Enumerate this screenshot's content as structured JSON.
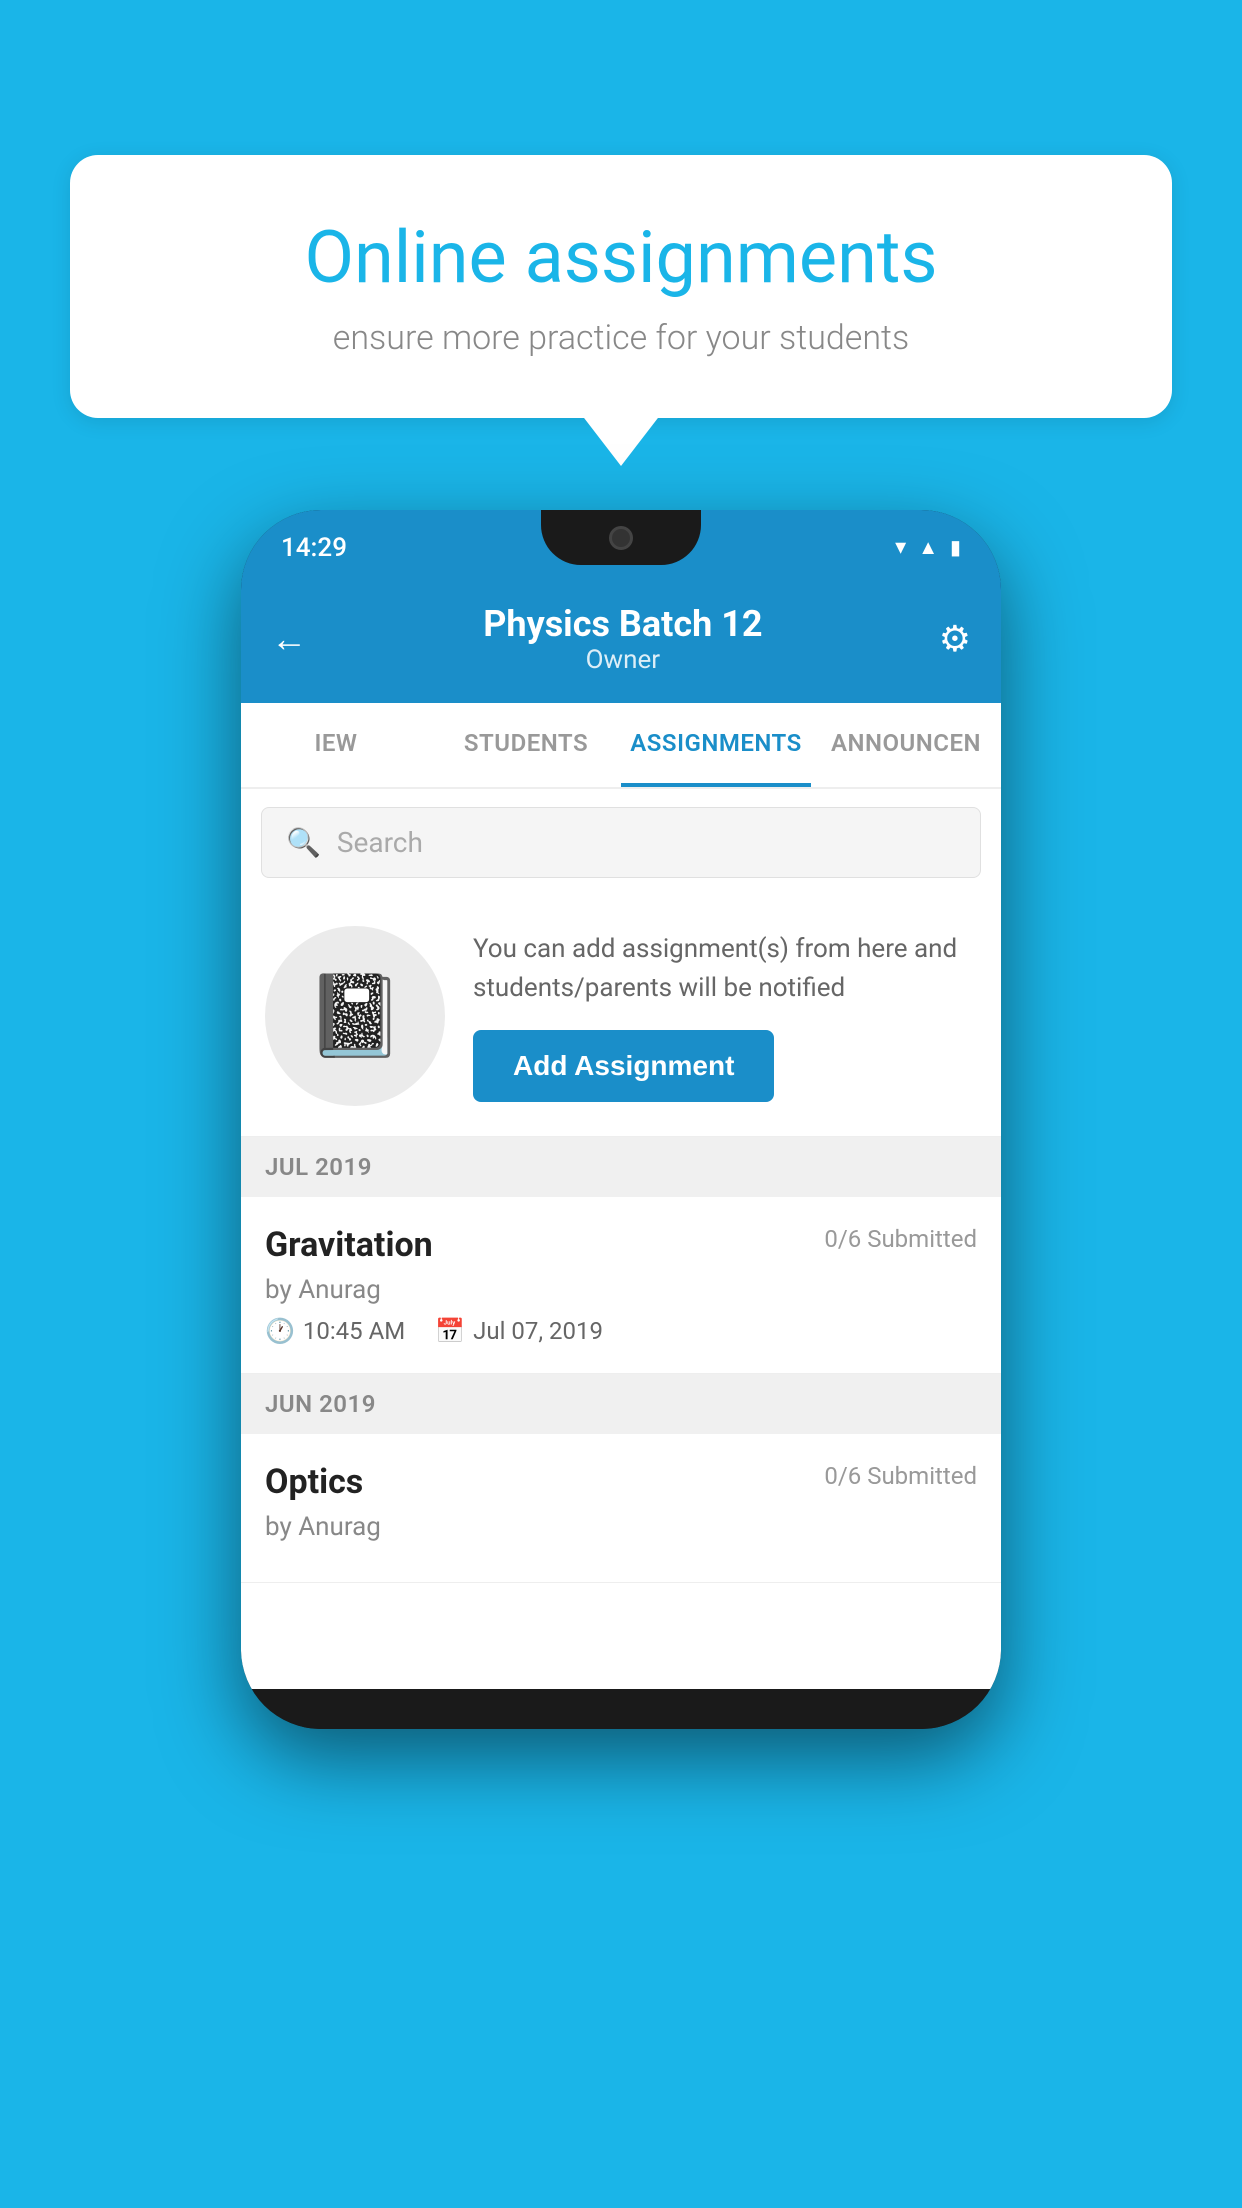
{
  "background_color": "#1ab5e8",
  "speech_bubble": {
    "title": "Online assignments",
    "subtitle": "ensure more practice for your students"
  },
  "phone": {
    "status_bar": {
      "time": "14:29"
    },
    "header": {
      "title": "Physics Batch 12",
      "subtitle": "Owner",
      "back_label": "←",
      "gear_label": "⚙"
    },
    "tabs": [
      {
        "label": "IEW",
        "active": false
      },
      {
        "label": "STUDENTS",
        "active": false
      },
      {
        "label": "ASSIGNMENTS",
        "active": true
      },
      {
        "label": "ANNOUNCEN",
        "active": false
      }
    ],
    "search": {
      "placeholder": "Search"
    },
    "promo": {
      "description": "You can add assignment(s) from here and students/parents will be notified",
      "button_label": "Add Assignment"
    },
    "sections": [
      {
        "month_label": "JUL 2019",
        "assignments": [
          {
            "name": "Gravitation",
            "submitted": "0/6 Submitted",
            "by": "by Anurag",
            "time": "10:45 AM",
            "date": "Jul 07, 2019"
          }
        ]
      },
      {
        "month_label": "JUN 2019",
        "assignments": [
          {
            "name": "Optics",
            "submitted": "0/6 Submitted",
            "by": "by Anurag",
            "time": "",
            "date": ""
          }
        ]
      }
    ]
  }
}
